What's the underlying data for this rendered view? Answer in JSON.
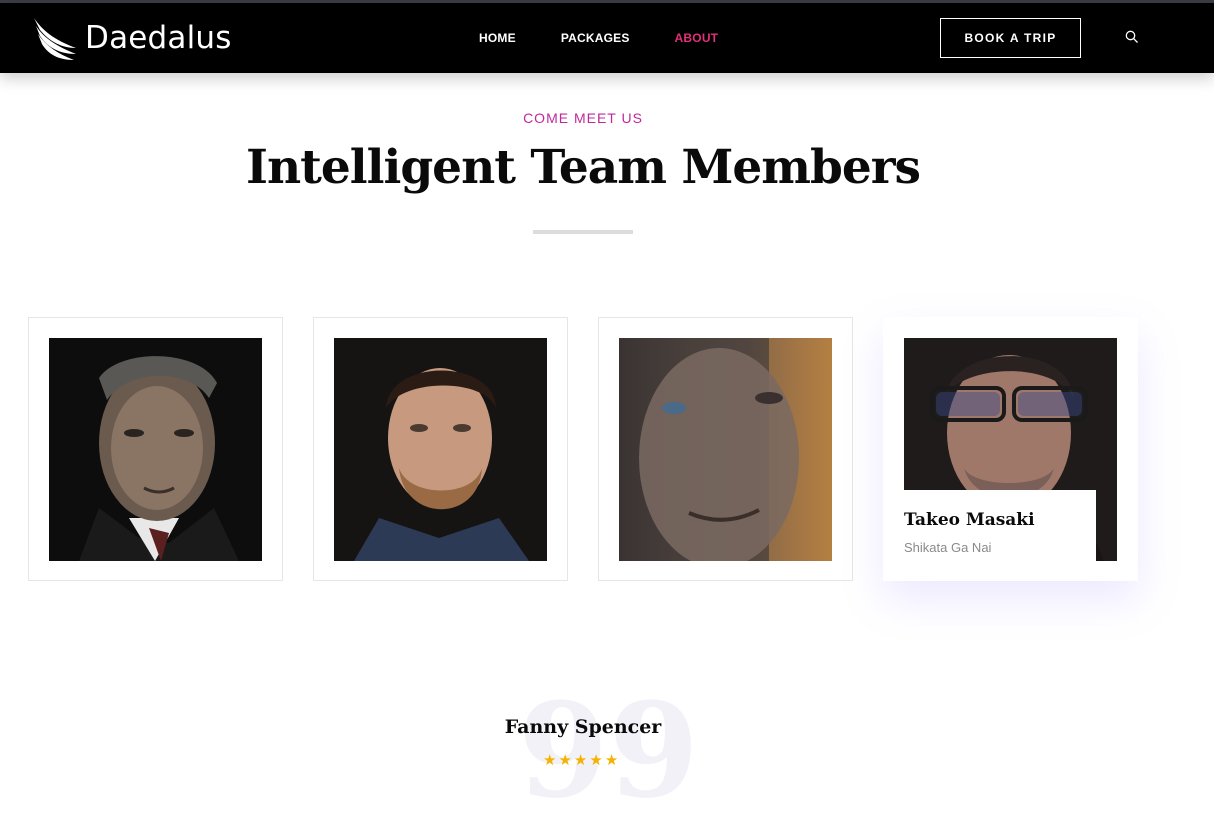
{
  "header": {
    "logo_text": "Daedalus",
    "nav": [
      {
        "label": "HOME",
        "active": false
      },
      {
        "label": "PACKAGES",
        "active": false
      },
      {
        "label": "ABOUT",
        "active": true
      }
    ],
    "cta_label": "BOOK A TRIP",
    "search_icon": "search-icon"
  },
  "section": {
    "eyebrow": "COME MEET US",
    "title": "Intelligent Team Members"
  },
  "team": [
    {
      "photo": "team-photo-1"
    },
    {
      "photo": "team-photo-2"
    },
    {
      "photo": "team-photo-3"
    },
    {
      "photo": "team-photo-4",
      "name": "Takeo Masaki",
      "role": "Shikata Ga Nai"
    }
  ],
  "testimonial": {
    "name": "Fanny Spencer",
    "rating": 5
  },
  "colors": {
    "header_bg": "#000000",
    "accent": "#e1307a",
    "eyebrow": "#c0299a",
    "star": "#f5b301"
  }
}
